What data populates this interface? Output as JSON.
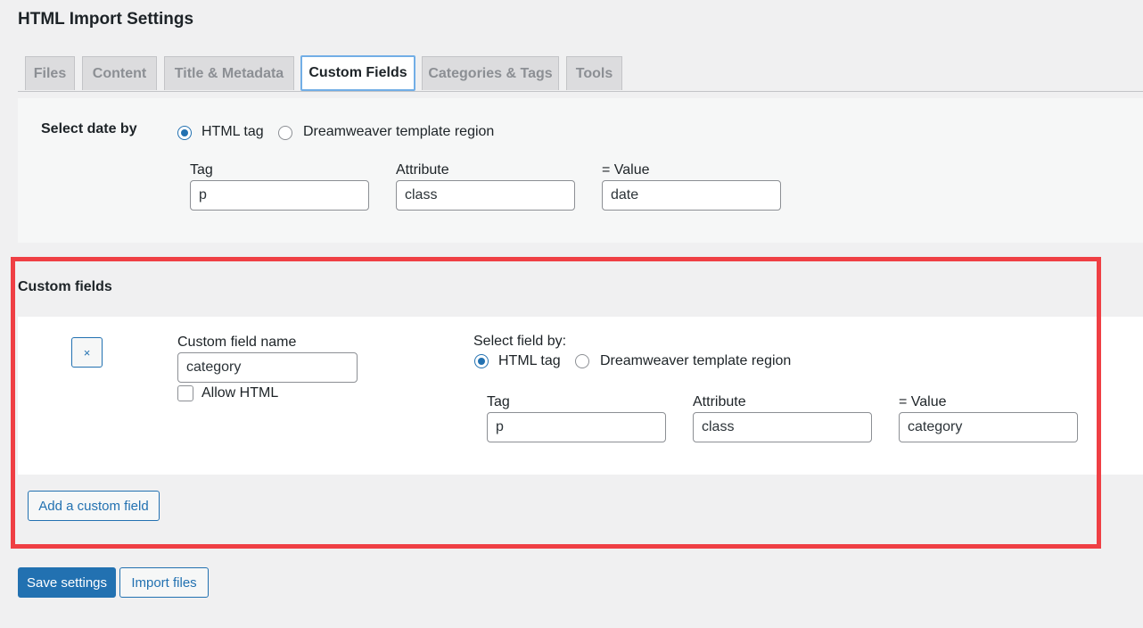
{
  "page": {
    "title": "HTML Import Settings"
  },
  "tabs": [
    {
      "label": "Files",
      "active": false
    },
    {
      "label": "Content",
      "active": false
    },
    {
      "label": "Title & Metadata",
      "active": false
    },
    {
      "label": "Custom Fields",
      "active": true
    },
    {
      "label": "Categories & Tags",
      "active": false
    },
    {
      "label": "Tools",
      "active": false
    }
  ],
  "date_section": {
    "label": "Select date by",
    "options": [
      {
        "label": "HTML tag",
        "checked": true
      },
      {
        "label": "Dreamweaver template region",
        "checked": false
      }
    ],
    "tag_label": "Tag",
    "tag_value": "p",
    "attribute_label": "Attribute",
    "attribute_value": "class",
    "value_label": "= Value",
    "value_value": "date"
  },
  "custom_fields": {
    "heading": "Custom fields",
    "remove_label": "×",
    "field_name_label": "Custom field name",
    "field_name_value": "category",
    "allow_html_label": "Allow HTML",
    "allow_html_checked": false,
    "select_by_label": "Select field by:",
    "options": [
      {
        "label": "HTML tag",
        "checked": true
      },
      {
        "label": "Dreamweaver template region",
        "checked": false
      }
    ],
    "tag_label": "Tag",
    "tag_value": "p",
    "attribute_label": "Attribute",
    "attribute_value": "class",
    "value_label": "= Value",
    "value_value": "category",
    "add_button_label": "Add a custom field"
  },
  "actions": {
    "save_label": "Save settings",
    "import_label": "Import files"
  },
  "colors": {
    "accent": "#2271b1",
    "highlight_border": "#ef3f44",
    "active_tab_border": "#72aee6"
  }
}
